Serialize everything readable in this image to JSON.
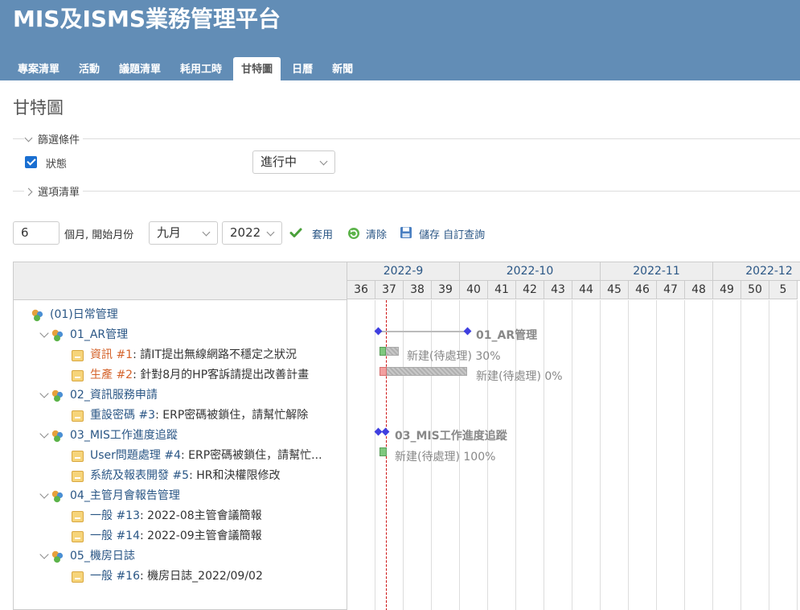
{
  "app": {
    "title": "MIS及ISMS業務管理平台",
    "tabs": [
      "專案清單",
      "活動",
      "議題清單",
      "耗用工時",
      "甘特圖",
      "日曆",
      "新聞"
    ],
    "selected_tab": "甘特圖"
  },
  "page_title": "甘特圖",
  "filters": {
    "legend": "篩選條件",
    "status_label": "狀態",
    "status_checked": true,
    "status_value": "進行中",
    "options_legend": "選項清單"
  },
  "controls": {
    "months_value": "6",
    "months_label": "個月, 開始月份",
    "start_month": "九月",
    "start_year": "2022",
    "apply_label": "套用",
    "clear_label": "清除",
    "save_label": "儲存 自訂查詢"
  },
  "gantt": {
    "months": [
      "2022-9",
      "2022-10",
      "2022-11",
      "2022-12"
    ],
    "weeks": [
      "36",
      "37",
      "38",
      "39",
      "40",
      "41",
      "42",
      "43",
      "44",
      "45",
      "46",
      "47",
      "48",
      "49",
      "50",
      "5"
    ],
    "rows": [
      {
        "kind": "project",
        "level": 0,
        "text": "(01)日常管理"
      },
      {
        "kind": "project",
        "level": 1,
        "text": "01_AR管理"
      },
      {
        "kind": "issue",
        "tracker": "資訊",
        "tracker_alt": true,
        "number": "#1",
        "subject": ": 請IT提出無線網路不穩定之狀況"
      },
      {
        "kind": "issue",
        "tracker": "生產",
        "tracker_alt": true,
        "number": "#2",
        "subject": ": 針對8月的HP客訴請提出改善計畫"
      },
      {
        "kind": "project",
        "level": 1,
        "text": "02_資訊服務申請"
      },
      {
        "kind": "issue",
        "tracker": "重設密碼",
        "tracker_alt": false,
        "number": "#3",
        "subject": ": ERP密碼被鎖住，請幫忙解除"
      },
      {
        "kind": "project",
        "level": 1,
        "text": "03_MIS工作進度追蹤"
      },
      {
        "kind": "issue",
        "tracker": "User問題處理",
        "tracker_alt": false,
        "number": "#4",
        "subject": ": ERP密碼被鎖住，請幫忙..."
      },
      {
        "kind": "issue",
        "tracker": "系統及報表開發",
        "tracker_alt": false,
        "number": "#5",
        "subject": ": HR和決權限修改"
      },
      {
        "kind": "project",
        "level": 1,
        "text": "04_主管月會報告管理"
      },
      {
        "kind": "issue",
        "tracker": "一般",
        "tracker_alt": false,
        "number": "#13",
        "subject": ": 2022-08主管會議簡報"
      },
      {
        "kind": "issue",
        "tracker": "一般",
        "tracker_alt": false,
        "number": "#14",
        "subject": ": 2022-09主管會議簡報"
      },
      {
        "kind": "project",
        "level": 1,
        "text": "05_機房日誌"
      },
      {
        "kind": "issue",
        "tracker": "一般",
        "tracker_alt": false,
        "number": "#16",
        "subject": ": 機房日誌_2022/09/02"
      }
    ],
    "bars": {
      "ar_label": "01_AR管理",
      "issue1_label": "新建(待處理) 30%",
      "issue2_label": "新建(待處理) 0%",
      "mis_label": "03_MIS工作進度追蹤",
      "issue4_label": "新建(待處理) 100%"
    }
  },
  "colors": {
    "header_bg": "#628db6",
    "link": "#2a5685",
    "tracker_alt": "#d4622a",
    "milestone": "#3f3fe0",
    "today_line": "#cc0000"
  }
}
